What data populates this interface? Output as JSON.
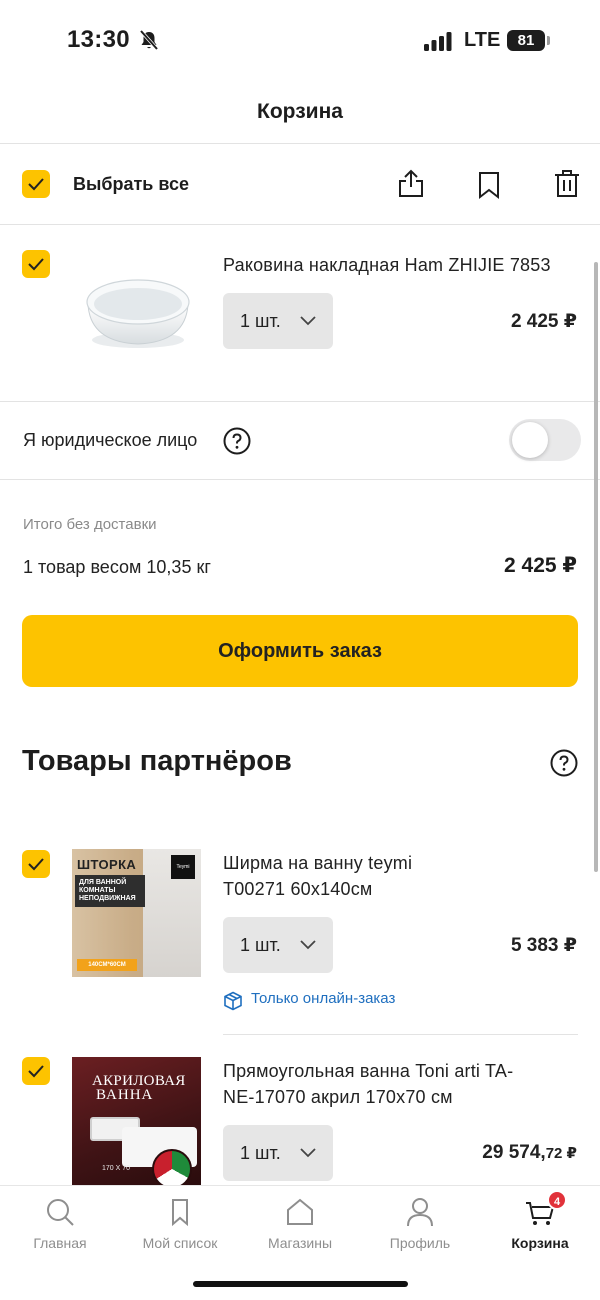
{
  "status_bar": {
    "time": "13:30",
    "network": "LTE",
    "battery": "81"
  },
  "header": {
    "title": "Корзина"
  },
  "toolbar": {
    "select_all_label": "Выбрать все"
  },
  "cart_item": {
    "title": "Раковина накладная Ham ZHIJIE 7853",
    "quantity": "1 шт.",
    "price": "2 425 ₽"
  },
  "legal_entity": {
    "label": "Я юридическое лицо",
    "enabled": false
  },
  "summary": {
    "caption": "Итого без доставки",
    "text": "1 товар весом 10,35 кг",
    "total": "2 425 ₽"
  },
  "checkout_button": "Оформить заказ",
  "partners": {
    "heading": "Товары партнёров",
    "items": [
      {
        "title_line1": "Ширма на ванну teymi",
        "title_line2": "T00271 60x140см",
        "quantity": "1 шт.",
        "price": "5 383 ₽",
        "note": "Только онлайн-заказ",
        "image_text": {
          "title": "ШТОРКА",
          "subtitle": "ДЛЯ ВАННОЙ КОМНАТЫ НЕПОДВИЖНАЯ",
          "size": "140СМ*60СМ",
          "logo": "Teymi"
        }
      },
      {
        "title_line1": "Прямоугольная ванна Toni arti TA-",
        "title_line2": "NE-17070 акрил 170x70 см",
        "quantity": "1 шт.",
        "price_main": "29 574,",
        "price_cents": "72 ₽",
        "image_text": {
          "line1": "АКРИЛОВАЯ",
          "line2": "ВАННА",
          "size": "170 X 70"
        }
      }
    ]
  },
  "tabbar": {
    "items": [
      {
        "label": "Главная",
        "icon": "search-icon"
      },
      {
        "label": "Мой список",
        "icon": "bookmark-icon"
      },
      {
        "label": "Магазины",
        "icon": "house-icon"
      },
      {
        "label": "Профиль",
        "icon": "person-icon"
      },
      {
        "label": "Корзина",
        "icon": "cart-icon",
        "badge": "4",
        "active": true
      }
    ]
  },
  "colors": {
    "accent": "#fdc300",
    "link": "#1f6fbf",
    "badge": "#e1323a"
  }
}
